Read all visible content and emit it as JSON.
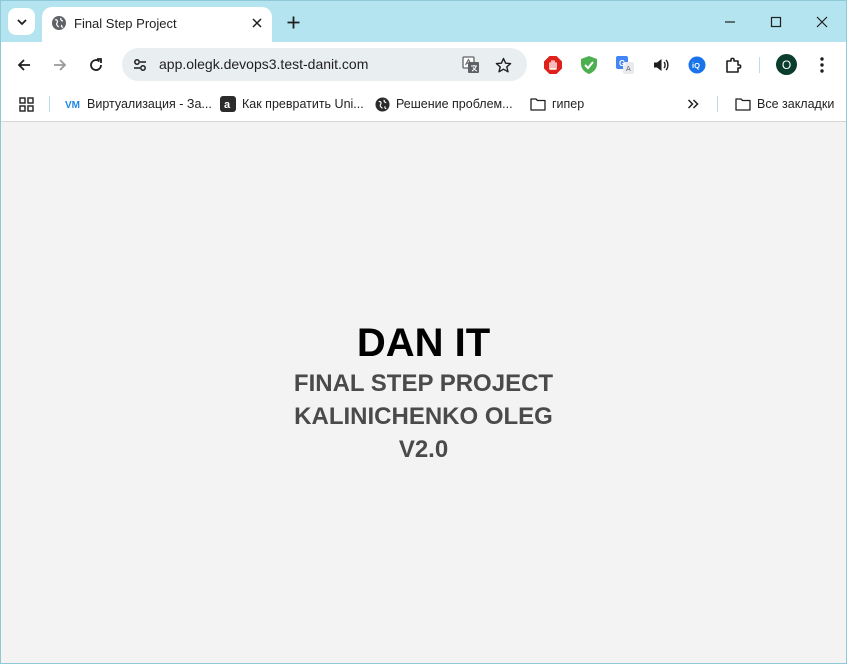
{
  "browser": {
    "tab": {
      "title": "Final Step Project"
    },
    "address_bar": {
      "url": "app.olegk.devops3.test-danit.com"
    },
    "profile": {
      "initial": "O"
    },
    "bookmarks": [
      {
        "label": "Виртуализация - За...",
        "icon": "vm-icon"
      },
      {
        "label": "Как превратить Uni...",
        "icon": "a-icon"
      },
      {
        "label": "Решение проблем...",
        "icon": "globe-icon"
      },
      {
        "label": "гипер",
        "icon": "folder-icon"
      }
    ],
    "all_bookmarks_label": "Все закладки",
    "extensions": [
      "adblock-icon",
      "shield-check-icon",
      "translate-icon",
      "volume-icon",
      "iq-icon",
      "puzzle-icon"
    ],
    "colors": {
      "tabstrip": "#b4e4f0",
      "page_background": "#f3f3f3",
      "avatar": "#0b3d2e"
    }
  },
  "page": {
    "title": "DAN IT",
    "lines": [
      "FINAL STEP PROJECT",
      "KALINICHENKO OLEG",
      "V2.0"
    ]
  }
}
